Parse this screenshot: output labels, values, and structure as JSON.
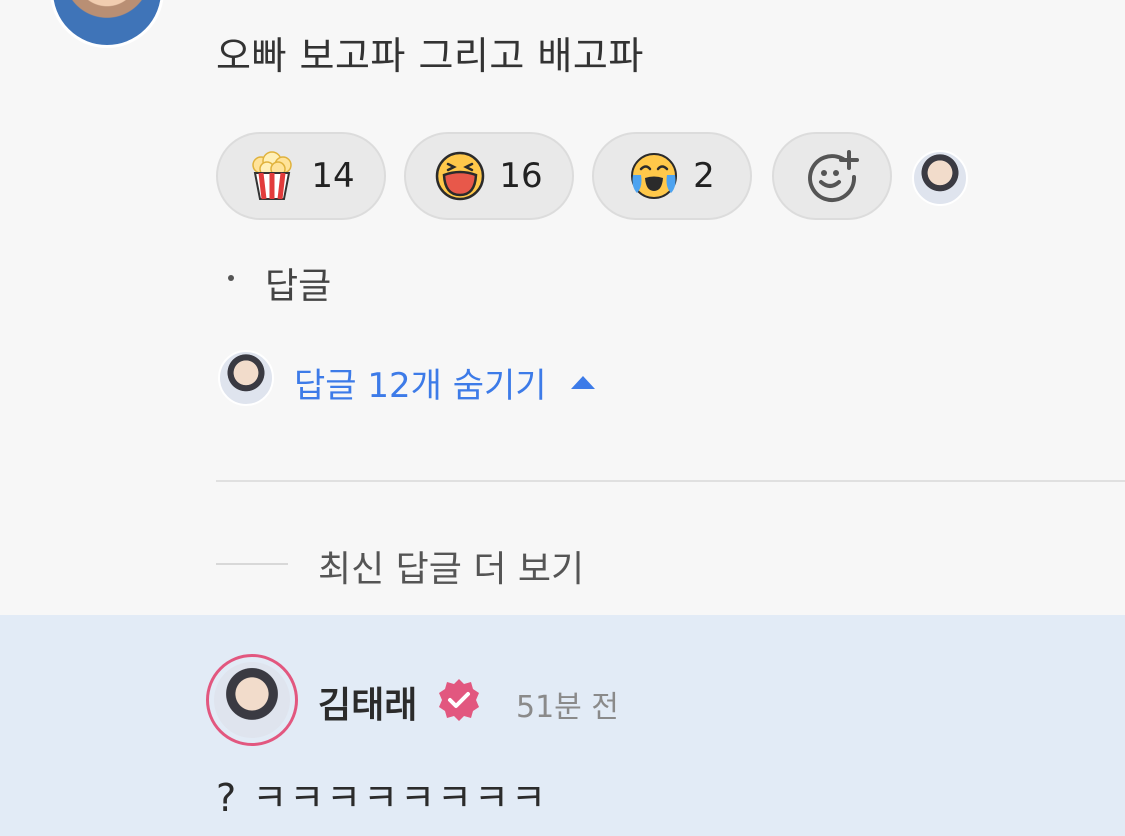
{
  "comment": {
    "text": "오빠 보고파 그리고 배고파"
  },
  "reactions": [
    {
      "icon": "popcorn-icon",
      "count": "14"
    },
    {
      "icon": "laughing-face-icon",
      "count": "16"
    },
    {
      "icon": "crying-laughing-face-icon",
      "count": "2"
    }
  ],
  "actions": {
    "reply_label": "답글",
    "add_reaction_icon": "add-reaction-icon"
  },
  "replies": {
    "toggle_label": "답글 12개 숨기기",
    "more_label": "최신 답글 더 보기"
  },
  "reply": {
    "author": "김태래",
    "timestamp": "51분 전",
    "text": "? ㅋㅋㅋㅋㅋㅋㅋㅋ"
  },
  "colors": {
    "link_blue": "#3d7be8",
    "verified_pink": "#e2577f",
    "highlight_bg": "#e2ebf6"
  }
}
